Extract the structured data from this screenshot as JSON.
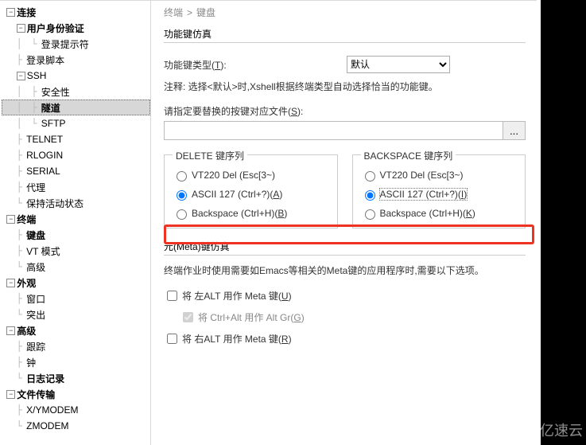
{
  "breadcrumb": {
    "a": "终端",
    "b": "键盘"
  },
  "tree": {
    "n0": "连接",
    "n1": "用户身份验证",
    "n2": "登录提示符",
    "n3": "登录脚本",
    "n4": "SSH",
    "n5": "安全性",
    "n6": "隧道",
    "n7": "SFTP",
    "n8": "TELNET",
    "n9": "RLOGIN",
    "n10": "SERIAL",
    "n11": "代理",
    "n12": "保持活动状态",
    "n13": "终端",
    "n14": "键盘",
    "n15": "VT 模式",
    "n16": "高级",
    "n17": "外观",
    "n18": "窗口",
    "n19": "突出",
    "n20": "高级",
    "n21": "跟踪",
    "n22": "钟",
    "n23": "日志记录",
    "n24": "文件传输",
    "n25": "X/YMODEM",
    "n26": "ZMODEM"
  },
  "fnkey": {
    "group": "功能键仿真",
    "type_label_pre": "功能键类型(",
    "type_hot": "T",
    "type_label_post": "):",
    "default_option": "默认",
    "note": "注释: 选择<默认>时,Xshell根据终端类型自动选择恰当的功能键。",
    "replace_pre": "请指定要替换的按键对应文件(",
    "replace_hot": "S",
    "replace_post": "):",
    "browse": "..."
  },
  "del": {
    "title": "DELETE 键序列",
    "opt1": "VT220 Del (Esc[3~)",
    "opt2_pre": "ASCII 127 (Ctrl+?)(",
    "opt2_hot": "A",
    "opt2_post": ")",
    "opt3_pre": "Backspace (Ctrl+H)(",
    "opt3_hot": "B",
    "opt3_post": ")"
  },
  "bs": {
    "title": "BACKSPACE 键序列",
    "opt1": "VT220 Del (Esc[3~)",
    "opt2_pre": "ASCII 127 (Ctrl+?)(",
    "opt2_hot": "I",
    "opt2_post": ")",
    "opt3_pre": "Backspace (Ctrl+H)(",
    "opt3_hot": "K",
    "opt3_post": ")"
  },
  "meta": {
    "group": "元(Meta)键仿真",
    "desc": "终端作业时使用需要如Emacs等相关的Meta键的应用程序时,需要以下选项。",
    "left_pre": "将 左ALT 用作 Meta 键(",
    "left_hot": "U",
    "left_post": ")",
    "altgr_pre": "将 Ctrl+Alt 用作 Alt Gr(",
    "altgr_hot": "G",
    "altgr_post": ")",
    "right_pre": "将 右ALT 用作 Meta 键(",
    "right_hot": "R",
    "right_post": ")"
  },
  "watermark": "亿速云"
}
